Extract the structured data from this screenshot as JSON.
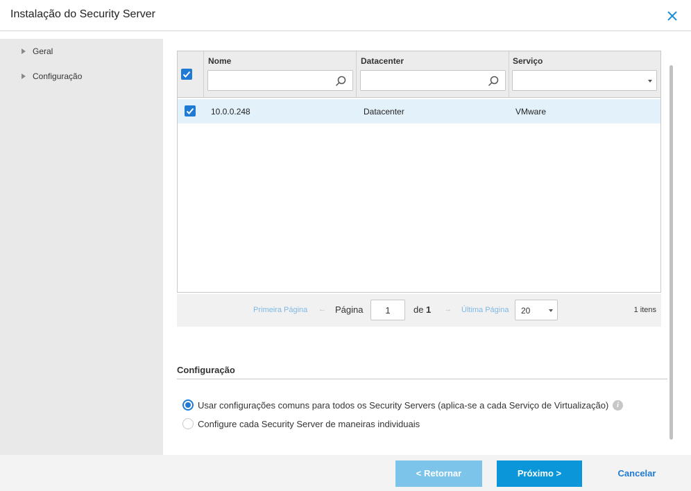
{
  "dialog": {
    "title": "Instalação do Security Server"
  },
  "sidebar": {
    "items": [
      {
        "label": "Geral"
      },
      {
        "label": "Configuração"
      }
    ]
  },
  "grid": {
    "columns": [
      {
        "label": "Nome"
      },
      {
        "label": "Datacenter"
      },
      {
        "label": "Serviço"
      }
    ],
    "filters": {
      "name_value": "",
      "datacenter_value": "",
      "service_value": ""
    },
    "select_all_checked": true,
    "rows": [
      {
        "checked": true,
        "name": "10.0.0.248",
        "datacenter": "Datacenter",
        "service": "VMware"
      }
    ]
  },
  "pager": {
    "first_label": "Primeira Página",
    "prev_arrow": "←",
    "page_label": "Página",
    "page_value": "1",
    "of_label": "de",
    "total_pages": "1",
    "next_arrow": "→",
    "last_label": "Última Página",
    "page_size": "20",
    "items_count": "1 itens"
  },
  "config": {
    "title": "Configuração",
    "options": [
      {
        "label": "Usar configurações comuns para todos os Security Servers (aplica-se a cada Serviço de Virtualização)",
        "selected": true
      },
      {
        "label": "Configure cada Security Server de maneiras individuais",
        "selected": false
      }
    ],
    "info_icon": "i"
  },
  "footer": {
    "back_label": "< Retornar",
    "next_label": "Próximo >",
    "cancel_label": "Cancelar"
  },
  "colors": {
    "accent": "#0a96d8",
    "accent_light": "#7cc4ea",
    "checkbox": "#1f7ad3",
    "row_selected": "#e3f1fb"
  }
}
